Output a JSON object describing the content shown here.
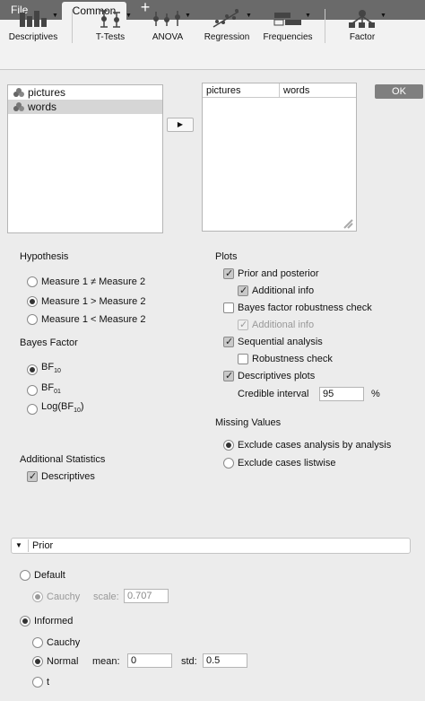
{
  "tabs": {
    "file": "File",
    "common": "Common",
    "add": "+"
  },
  "ribbon": [
    {
      "label": "Descriptives",
      "icon": "descriptives-icon"
    },
    {
      "label": "T-Tests",
      "icon": "t-tests-icon"
    },
    {
      "label": "ANOVA",
      "icon": "anova-icon"
    },
    {
      "label": "Regression",
      "icon": "regression-icon"
    },
    {
      "label": "Frequencies",
      "icon": "frequencies-icon"
    },
    {
      "label": "Factor",
      "icon": "factor-icon"
    }
  ],
  "ok_label": "OK",
  "variables": [
    "pictures",
    "words"
  ],
  "target_columns": [
    "pictures",
    "words"
  ],
  "hypothesis": {
    "title": "Hypothesis",
    "options": [
      "Measure 1 ≠ Measure 2",
      "Measure 1 > Measure 2",
      "Measure 1 < Measure 2"
    ],
    "selected": 1
  },
  "bayes_factor": {
    "title": "Bayes Factor",
    "options": [
      {
        "main": "BF",
        "sub": "10",
        "after": ""
      },
      {
        "main": "BF",
        "sub": "01",
        "after": ""
      },
      {
        "main": "Log(BF",
        "sub": "10",
        "after": ")"
      }
    ],
    "selected": 0
  },
  "additional_stats": {
    "title": "Additional Statistics",
    "descriptives": "Descriptives",
    "checked": true
  },
  "plots": {
    "title": "Plots",
    "prior_posterior": "Prior and posterior",
    "additional_info_1": "Additional info",
    "robustness": "Bayes factor robustness check",
    "additional_info_2": "Additional info",
    "sequential": "Sequential analysis",
    "robustness_check": "Robustness check",
    "descriptives_plots": "Descriptives plots",
    "credible_interval_label": "Credible interval",
    "credible_interval_value": "95",
    "percent": "%"
  },
  "missing": {
    "title": "Missing Values",
    "options": [
      "Exclude cases analysis by analysis",
      "Exclude cases listwise"
    ],
    "selected": 0
  },
  "prior": {
    "title": "Prior",
    "default": "Default",
    "cauchy_label": "Cauchy",
    "scale_label": "scale:",
    "scale_value": "0.707",
    "informed": "Informed",
    "informed_cauchy": "Cauchy",
    "normal": "Normal",
    "mean_label": "mean:",
    "mean_value": "0",
    "std_label": "std:",
    "std_value": "0.5",
    "t": "t"
  }
}
